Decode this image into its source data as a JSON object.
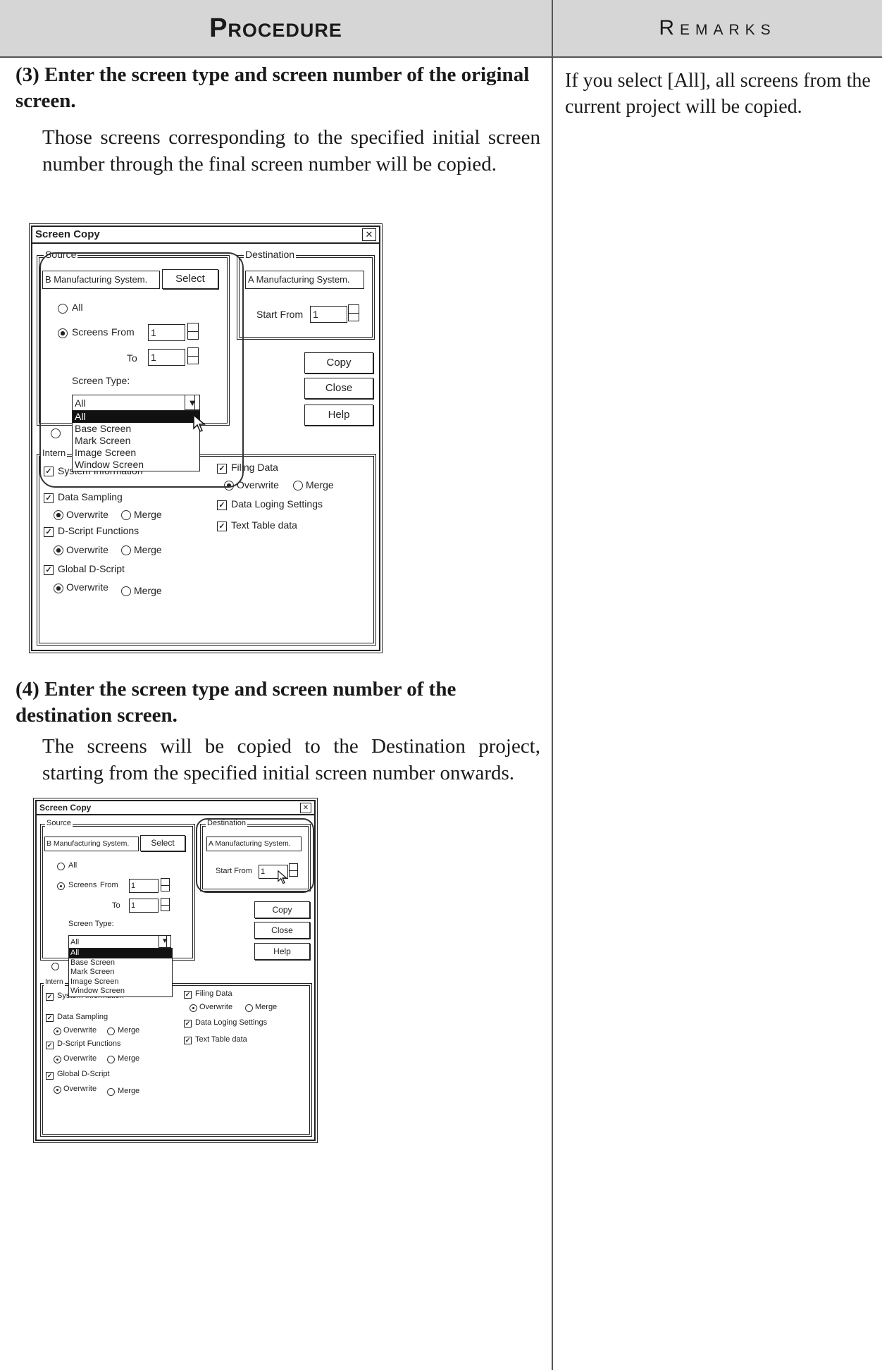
{
  "header": {
    "procedure": "Procedure",
    "remarks": "Remarks"
  },
  "step3": {
    "number": "(3)",
    "title": "Enter the screen type and screen number of the original screen.",
    "body": "Those screens corresponding to the specified initial screen number through the final screen number will be copied."
  },
  "step4": {
    "number": "(4)",
    "title": "Enter the screen type and screen number of the destination screen.",
    "body": "The screens will be copied to the Destination project, starting from the specified initial screen number onwards."
  },
  "remark": "If you select [All], all screens from the current project will be copied.",
  "dialog": {
    "title": "Screen Copy",
    "close_glyph": "✕",
    "source_label": "Source",
    "source_project": "B Manufacturing System.",
    "select_label": "Select",
    "all_label": "All",
    "screens_label": "Screens",
    "from_label": "From",
    "from_value": "1",
    "to_label": "To",
    "to_value": "1",
    "screen_type_label": "Screen Type:",
    "screen_type_value": "All",
    "dropdown_options": [
      "All",
      "Base Screen",
      "Mark Screen",
      "Image Screen",
      "Window Screen"
    ],
    "destination_label": "Destination",
    "destination_project": "A Manufacturing System.",
    "start_from_label": "Start From",
    "start_from_value": "1",
    "copy_label": "Copy",
    "close_label": "Close",
    "help_label": "Help",
    "internal_label": "Intern",
    "system_info_label": "System Information",
    "data_sampling_label": "Data Sampling",
    "dscript_label": "D-Script Functions",
    "global_dscript_label": "Global D-Script",
    "filing_label": "Filing Data",
    "data_logging_label": "Data Loging Settings",
    "text_table_label": "Text Table data",
    "overwrite_label": "Overwrite",
    "merge_label": "Merge",
    "check_glyph": "✓"
  }
}
